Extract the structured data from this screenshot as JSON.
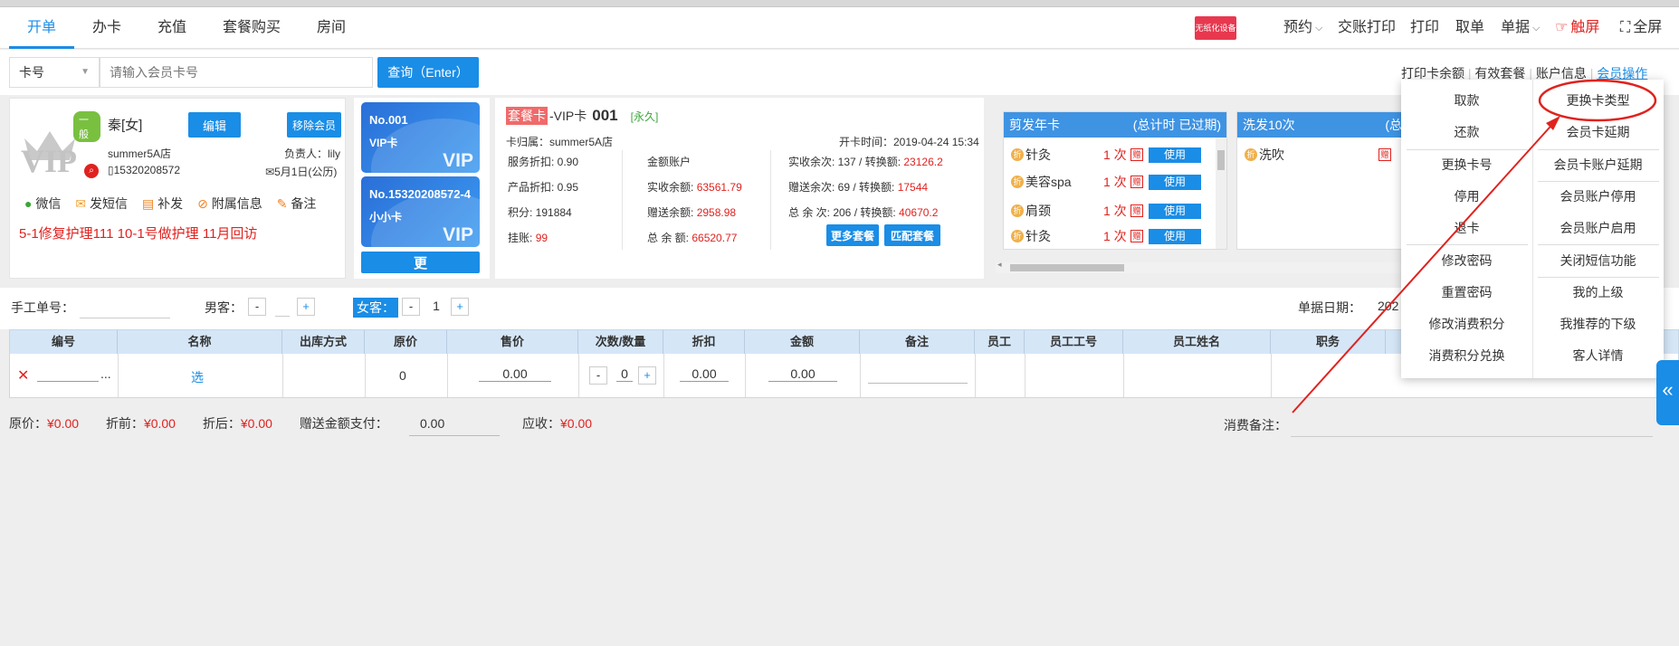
{
  "tabs": [
    {
      "label": "开单",
      "active": true
    },
    {
      "label": "办卡"
    },
    {
      "label": "充值"
    },
    {
      "label": "套餐购买"
    },
    {
      "label": "房间"
    }
  ],
  "topright": {
    "device_badge": "无纸化设备",
    "booking": "预约",
    "handover_print": "交账打印",
    "print": "打印",
    "take_order": "取单",
    "receipt": "单据",
    "touch": "触屏",
    "fullscreen": "全屏"
  },
  "search": {
    "select_value": "卡号",
    "placeholder": "请输入会员卡号",
    "query_button": "查询（Enter）"
  },
  "links": {
    "print_balance": "打印卡余额",
    "valid_packages": "有效套餐",
    "account_info": "账户信息",
    "member_ops": "会员操作"
  },
  "member": {
    "level_badge": "一般",
    "name": "秦[女]",
    "edit_button": "编辑",
    "remove_button": "移除会员",
    "store": "summer5A店",
    "owner_label": "负责人：",
    "owner": "lily",
    "phone": "15320208572",
    "birthday": "5月1日(公历)",
    "actions": [
      "微信",
      "发短信",
      "补发",
      "附属信息",
      "备注"
    ],
    "notes": "5-1修复护理111 10-1号做护理 11月回访",
    "vip_logo": "VIP"
  },
  "cards": [
    {
      "number": "No.001",
      "type": "VIP卡",
      "mark": "VIP"
    },
    {
      "number": "No.15320208572-4",
      "type": "小小卡",
      "mark": "VIP"
    }
  ],
  "more_button": "更",
  "card_info": {
    "tag": "套餐卡",
    "card_type": "-VIP卡",
    "card_no": "001",
    "validity": "[永久]",
    "owner_store": "卡归属：summer5A店",
    "open_time": "开卡时间：2019-04-24 15:34",
    "service_discount": "服务折扣: 0.90",
    "product_discount": "产品折扣: 0.95",
    "points": "积分: 191884",
    "credit_label": "挂账:",
    "credit_value": "99",
    "amount_account": "金额账户",
    "real_balance_label": "实收余额:",
    "real_balance": "63561.79",
    "gift_balance_label": "赠送余额:",
    "gift_balance": "2958.98",
    "total_balance_label": "总 余 额:",
    "total_balance": "66520.77",
    "real_times_label": "实收余次: 137 / 转换额:",
    "real_times_value": "23126.2",
    "gift_times_label": "赠送余次: 69 / 转换额:",
    "gift_times_value": "17544",
    "total_times_label": "总 余 次: 206 / 转换额:",
    "total_times_value": "40670.2",
    "more_packages": "更多套餐",
    "match_packages": "匹配套餐"
  },
  "package1": {
    "title": "剪发年卡",
    "status": "(总计时 已过期)",
    "items": [
      {
        "name": "针灸",
        "count": "1 次",
        "use": "使用"
      },
      {
        "name": "美容spa",
        "count": "1 次",
        "use": "使用"
      },
      {
        "name": "肩颈",
        "count": "1 次",
        "use": "使用"
      },
      {
        "name": "针灸",
        "count": "1 次",
        "use": "使用"
      }
    ],
    "disc_tag": "折",
    "gift_tag": "赠"
  },
  "package2": {
    "title": "洗发10次",
    "status": "(总",
    "items": [
      {
        "name": "洗吹"
      }
    ]
  },
  "workrow": {
    "manual_no_label": "手工单号：",
    "male_label": "男客：",
    "male_value": "",
    "female_label": "女客：",
    "female_value": "1",
    "date_label": "单据日期：",
    "date_value": "202"
  },
  "grid": {
    "headers": [
      "编号",
      "名称",
      "出库方式",
      "原价",
      "售价",
      "次数/数量",
      "折扣",
      "金额",
      "备注",
      "员工",
      "员工工号",
      "员工姓名",
      "职务"
    ],
    "row": {
      "delete": "✕",
      "dots": "...",
      "select": "选",
      "orig_price": "0",
      "sale_price": "0.00",
      "qty": "0",
      "discount": "0.00",
      "amount": "0.00"
    }
  },
  "summary": {
    "orig_label": "原价：",
    "orig_value": "¥0.00",
    "before_label": "折前：",
    "before_value": "¥0.00",
    "after_label": "折后：",
    "after_value": "¥0.00",
    "gift_pay_label": "赠送金额支付：",
    "gift_pay_value": "0.00",
    "receivable_label": "应收：",
    "receivable_value": "¥0.00",
    "remark_label": "消费备注："
  },
  "menu": {
    "left": [
      "取款",
      "还款",
      "更换卡号",
      "停用",
      "退卡",
      "修改密码",
      "重置密码",
      "修改消费积分",
      "消费积分兑换"
    ],
    "right": [
      "更换卡类型",
      "会员卡延期",
      "会员卡账户延期",
      "会员账户停用",
      "会员账户启用",
      "关闭短信功能",
      "我的上级",
      "我推荐的下级",
      "客人详情"
    ]
  },
  "side_toggle": "«",
  "colors": {
    "accent": "#1a8de6",
    "red": "#e0221f",
    "header_blue": "#3f93e3"
  }
}
